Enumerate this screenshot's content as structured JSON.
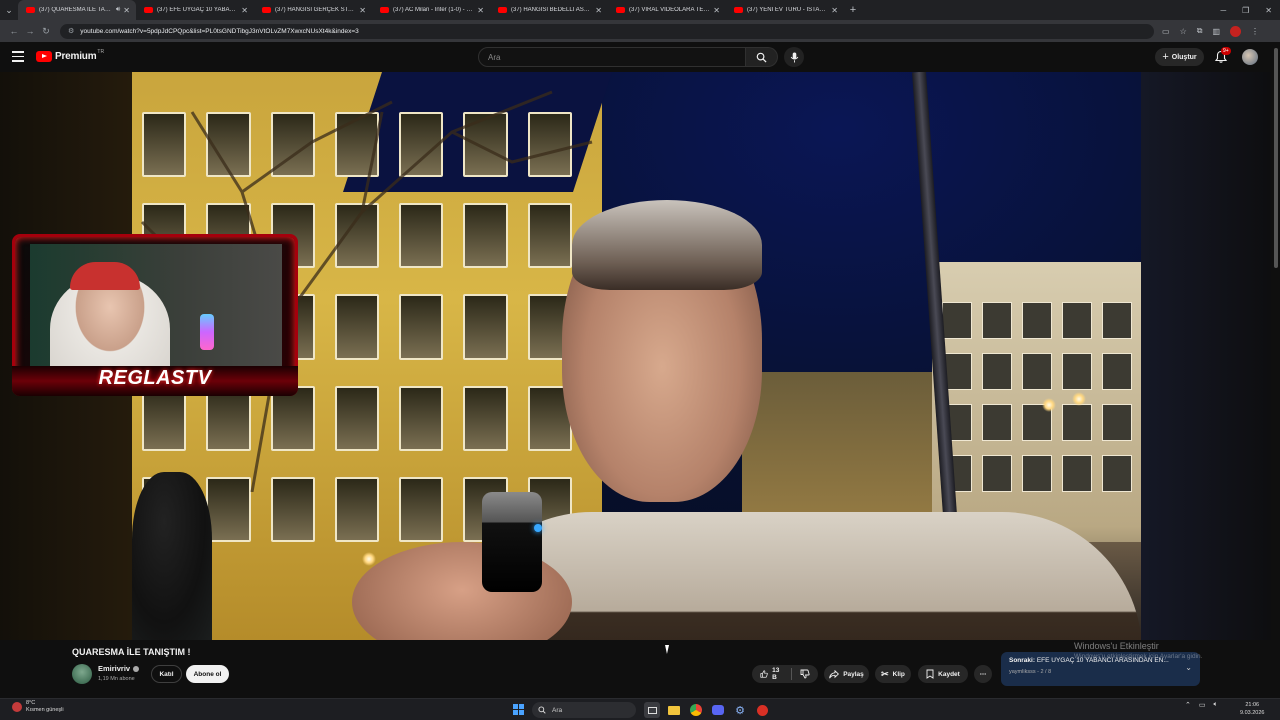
{
  "browser": {
    "tabs": [
      {
        "title": "(37) QUARESMA İLE TANIŞ",
        "active": true,
        "muted_icon": "speaker-icon"
      },
      {
        "title": "(37) EFE UYGAÇ 10 YABANCI A",
        "active": false
      },
      {
        "title": "(37) HANGİSİ GERÇEK STAND-U",
        "active": false
      },
      {
        "title": "(37) AC Milan - Inter (1-0) - Ma",
        "active": false
      },
      {
        "title": "(37) HANGİSİ BEDELLİ ASKER D",
        "active": false
      },
      {
        "title": "(37) VİRAL VİDEOLARA TEPKİ",
        "active": false
      },
      {
        "title": "(37) YENİ EV TURU - İSTANBUL",
        "active": false
      }
    ],
    "url": "youtube.com/watch?v=5pdpJdCPQpc&list=PL0tsGNDTibgJ3nVtOLvZM7XwxcNUsXt4k&index=3"
  },
  "masthead": {
    "brand": "Premium",
    "country_code": "TR",
    "search_placeholder": "Ara",
    "create_label": "Oluştur",
    "notifications_badge": "9+"
  },
  "overlay": {
    "brand_text": "REGLASTV"
  },
  "video": {
    "title": "QUARESMA İLE TANIŞTIM !",
    "channel_name": "Emirivriv",
    "subscribers": "1,19 Mn abone",
    "join_label": "Katıl",
    "subscribe_label": "Abone ol",
    "likes": "13 B",
    "share_label": "Paylaş",
    "clip_label": "Klip",
    "save_label": "Kaydet"
  },
  "up_next": {
    "prefix": "Sonraki:",
    "title": "EFE UYGAÇ 10 YABANCI ARASINDAN EN...",
    "playlist": "yaymliksss - 2 / 8"
  },
  "windows_watermark": {
    "title": "Windows'u Etkinleştir",
    "subtitle": "Windows'u etkinleştirmek için Ayarlar'a gidin."
  },
  "taskbar": {
    "weather_temp": "8°C",
    "weather_desc": "Kısmen güneşli",
    "search_placeholder": "Ara",
    "time": "21:06",
    "date": "9.03.2026"
  }
}
